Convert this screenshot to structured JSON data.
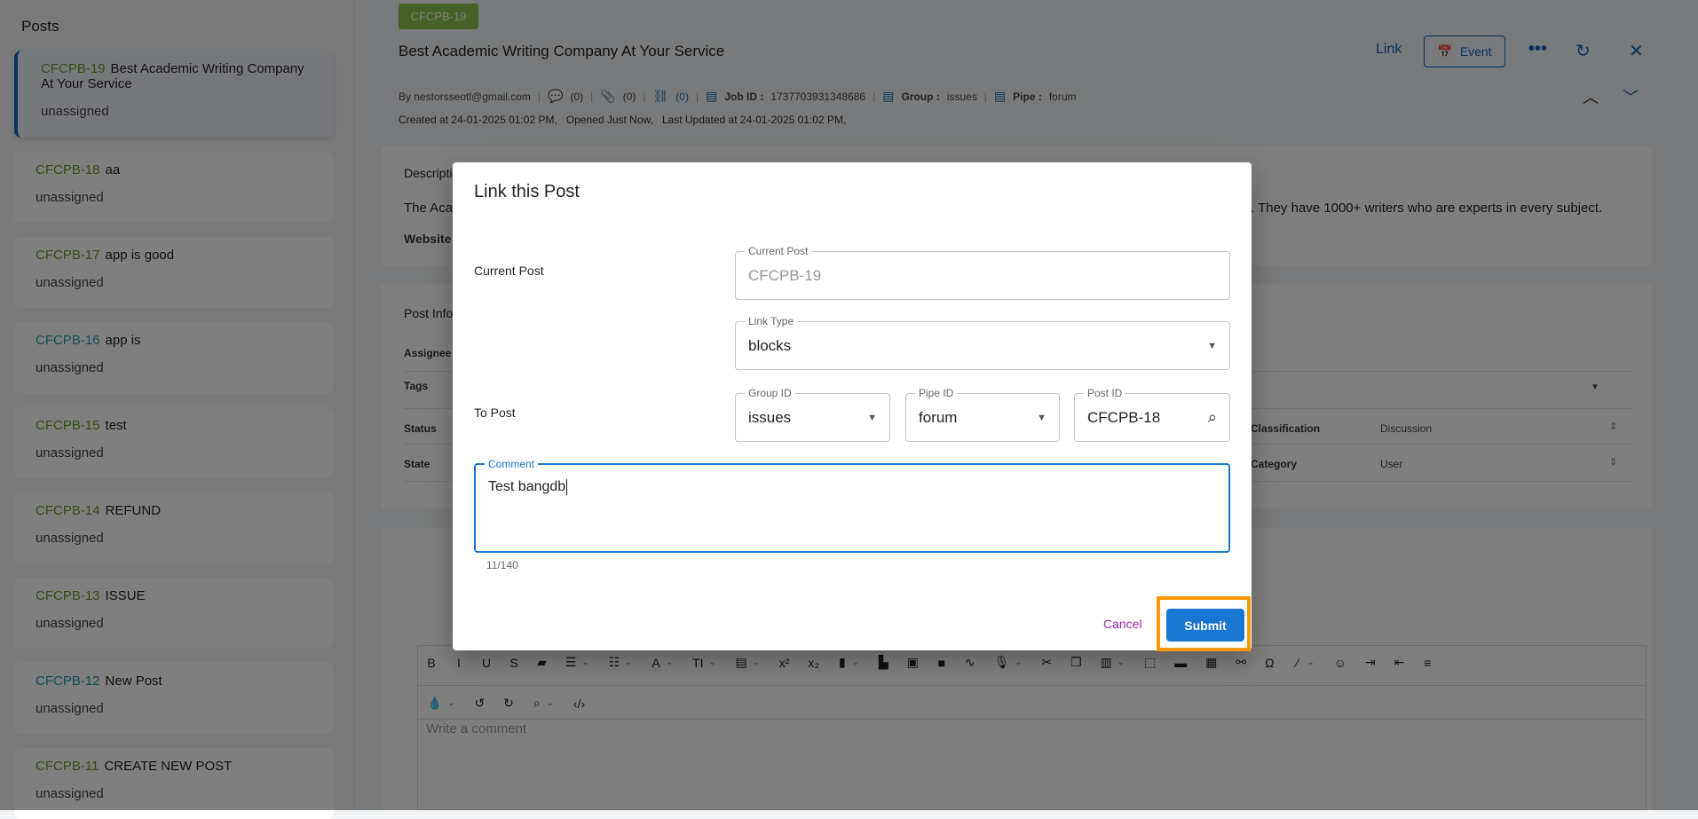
{
  "sidebar": {
    "title": "Posts",
    "items": [
      {
        "id": "CFCPB-19",
        "title": "Best Academic Writing Company At Your Service",
        "assignee": "unassigned",
        "active": true
      },
      {
        "id": "CFCPB-18",
        "title": "aa",
        "assignee": "unassigned"
      },
      {
        "id": "CFCPB-17",
        "title": "app is good",
        "assignee": "unassigned"
      },
      {
        "id": "CFCPB-16",
        "title": "app is",
        "assignee": "unassigned"
      },
      {
        "id": "CFCPB-15",
        "title": "test",
        "assignee": "unassigned"
      },
      {
        "id": "CFCPB-14",
        "title": "REFUND",
        "assignee": "unassigned"
      },
      {
        "id": "CFCPB-13",
        "title": "ISSUE",
        "assignee": "unassigned"
      },
      {
        "id": "CFCPB-12",
        "title": "New Post",
        "assignee": "unassigned"
      },
      {
        "id": "CFCPB-11",
        "title": "CREATE NEW POST",
        "assignee": "unassigned"
      }
    ]
  },
  "post": {
    "badge": "CFCPB-19",
    "title": "Best Academic Writing Company At Your Service",
    "author": "By nestorsseotl@gmail.com",
    "comments": "(0)",
    "attachments": "(0)",
    "links": "(0)",
    "job_label": "Job ID :",
    "job_id": "1737703931348686",
    "group_label": "Group :",
    "group": "issues",
    "pipe_label": "Pipe :",
    "pipe": "forum",
    "created": "Created at 24-01-2025 01:02 PM,   Opened Just Now,   Last Updated at 24-01-2025 01:02 PM,"
  },
  "toolbar": {
    "link": "Link",
    "event": "Event"
  },
  "description": {
    "label": "Description",
    "text_start": "The Aca",
    "text_end": ". They have 1000+ writers who are experts in every subject.",
    "website": "Website"
  },
  "post_info": {
    "label": "Post Info",
    "assignee": "Assignee",
    "tags": "Tags",
    "status": "Status",
    "state": "State",
    "classification_label": "Classification",
    "classification": "Discussion",
    "category_label": "Category",
    "category": "User"
  },
  "editor": {
    "placeholder": "Write a comment",
    "row1": [
      [
        "bold",
        "B"
      ],
      [
        "italic",
        "I"
      ],
      [
        "underline",
        "U"
      ],
      [
        "strikethrough",
        "S"
      ],
      [
        "eraser",
        "▰"
      ],
      [
        "bullet-list",
        "☰"
      ],
      [
        "chevron-down",
        "⌄"
      ],
      [
        "numbered-list",
        "☷"
      ],
      [
        "chevron-down",
        "⌄"
      ],
      [
        "font-color",
        "A"
      ],
      [
        "chevron-down",
        "⌄"
      ],
      [
        "font-size",
        "TI"
      ],
      [
        "chevron-down",
        "⌄"
      ],
      [
        "paragraph",
        "▤"
      ],
      [
        "chevron-down",
        "⌄"
      ],
      [
        "superscript",
        "x²"
      ],
      [
        "subscript",
        "x₂"
      ],
      [
        "block",
        "▮"
      ],
      [
        "chevron-down",
        "⌄"
      ],
      [
        "file",
        "▙"
      ],
      [
        "image",
        "▣"
      ],
      [
        "video",
        "■"
      ],
      [
        "signature",
        "∿"
      ],
      [
        "microphone",
        "🎙"
      ],
      [
        "chevron-down",
        "⌄"
      ],
      [
        "scissors",
        "✂"
      ],
      [
        "copy",
        "❐"
      ],
      [
        "paste",
        "▥"
      ],
      [
        "chevron-down",
        "⌄"
      ],
      [
        "select-all",
        "⬚"
      ],
      [
        "horizontal-rule",
        "▬"
      ],
      [
        "table",
        "▦"
      ],
      [
        "link",
        "⚯"
      ],
      [
        "omega",
        "Ω"
      ],
      [
        "magic",
        "⁄"
      ],
      [
        "chevron-down",
        "⌄"
      ],
      [
        "emoji",
        "☺"
      ],
      [
        "indent",
        "⇥"
      ],
      [
        "outdent",
        "⇤"
      ],
      [
        "align",
        "≡"
      ]
    ],
    "row2": [
      [
        "ink",
        "💧"
      ],
      [
        "chevron-down",
        "⌄"
      ],
      [
        "undo",
        "↺"
      ],
      [
        "redo",
        "↻"
      ],
      [
        "search",
        "⌕"
      ],
      [
        "chevron-down",
        "⌄"
      ],
      [
        "code",
        "‹/›"
      ]
    ]
  },
  "modal": {
    "title": "Link this Post",
    "current_post_label": "Current Post",
    "current_post_legend": "Current Post",
    "current_post_value": "CFCPB-19",
    "link_type_legend": "Link Type",
    "link_type_value": "blocks",
    "to_post_label": "To Post",
    "group_legend": "Group ID",
    "group_value": "issues",
    "pipe_legend": "Pipe ID",
    "pipe_value": "forum",
    "post_legend": "Post ID",
    "post_value": "CFCPB-18",
    "comment_legend": "Comment",
    "comment_value": "Test bangdb",
    "counter": "11/140",
    "cancel": "Cancel",
    "submit": "Submit"
  },
  "colors": {
    "accent": "#1976d2",
    "highlight": "#ff9800",
    "badge": "#8bc34a",
    "cancel": "#9c27b0"
  }
}
